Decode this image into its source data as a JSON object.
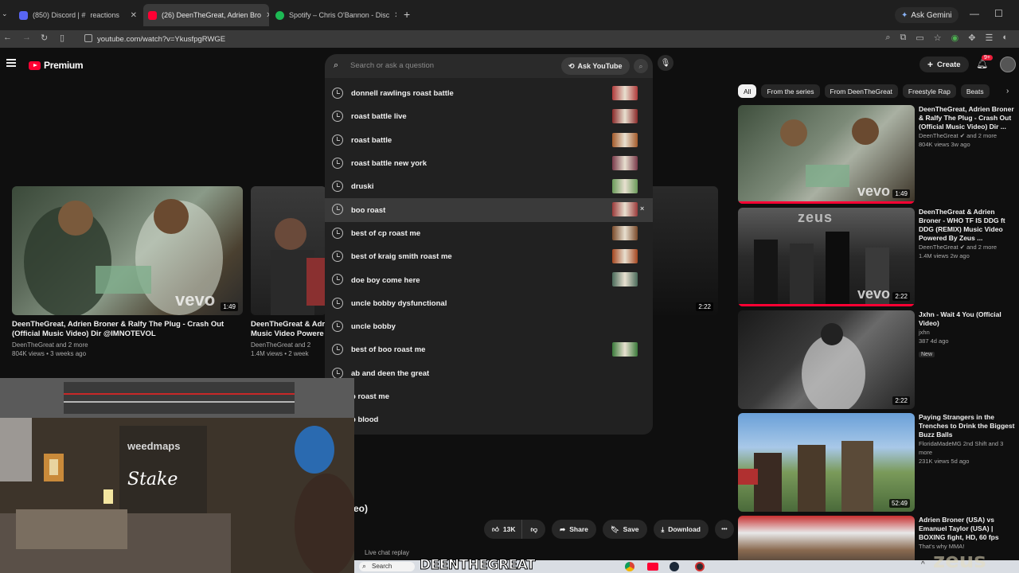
{
  "browser": {
    "tabs": [
      {
        "label": "(850) Discord | #",
        "extra": "reactions",
        "favicon_color": "#5865f2"
      },
      {
        "label": "(26) DeenTheGreat, Adrien Bro",
        "favicon_color": "#ff0033"
      },
      {
        "label": "Spotify – Chris O'Bannon - Disc",
        "favicon_color": "#1db954"
      }
    ],
    "new_tab": "+",
    "ask_gemini": "Ask Gemini",
    "url": "youtube.com/watch?v=YkusfpgRWGE"
  },
  "header": {
    "logo_text": "Premium",
    "search_placeholder": "Search or ask a question",
    "ask_youtube": "Ask YouTube",
    "create_label": "Create",
    "notif_count": "9+"
  },
  "suggestions": [
    {
      "text": "donnell rawlings roast battle",
      "has_thumb": true,
      "thumb_color": "#b03a3a"
    },
    {
      "text": "roast battle live",
      "has_thumb": true,
      "thumb_color": "#8a2a2a"
    },
    {
      "text": "roast battle",
      "has_thumb": true,
      "thumb_color": "#a35a2a"
    },
    {
      "text": "roast battle new york",
      "has_thumb": true,
      "thumb_color": "#7a3a4a"
    },
    {
      "text": "druski",
      "has_thumb": true,
      "thumb_color": "#6a9a5a"
    },
    {
      "text": "boo roast",
      "has_thumb": true,
      "thumb_color": "#9a3a3a",
      "hover": true,
      "remove": "×"
    },
    {
      "text": "best of cp roast me",
      "has_thumb": true,
      "thumb_color": "#7a4a2a"
    },
    {
      "text": "best of kraig smith roast me",
      "has_thumb": true,
      "thumb_color": "#a4461f"
    },
    {
      "text": "doe boy come here",
      "has_thumb": true,
      "thumb_color": "#4a6a5a"
    },
    {
      "text": "uncle bobby dysfunctional",
      "has_thumb": false
    },
    {
      "text": "uncle bobby",
      "has_thumb": false
    },
    {
      "text": "best of boo roast me",
      "has_thumb": true,
      "thumb_color": "#3a7a3a"
    },
    {
      "text": "ab and deen the great",
      "has_thumb": false
    },
    {
      "text": "p roast me",
      "has_thumb": false
    },
    {
      "text": "b blood",
      "has_thumb": false
    }
  ],
  "left_videos": [
    {
      "title": "DeenTheGreat, Adrien Broner & Ralfy The Plug - Crash Out (Official Music Video) Dir @IMNOTEVOL",
      "channel": "DeenTheGreat and 2 more",
      "stats": "804K views • 3 weeks ago",
      "duration": "1:49",
      "watermark": "vevo"
    },
    {
      "title": "DeenTheGreat & Adr",
      "title2": "Music Video Powere",
      "channel": "DeenTheGreat and 2",
      "stats": "1.4M views • 2 week",
      "duration": ""
    },
    {
      "duration": "2:22"
    }
  ],
  "chips": [
    "All",
    "From the series",
    "From DeenTheGreat",
    "Freestyle Rap",
    "Beats"
  ],
  "right_videos": [
    {
      "title": "DeenTheGreat, Adrien Broner & Ralfy The Plug - Crash Out (Official Music Video) Dir ...",
      "channel": "DeenTheGreat",
      "channel_more": "and 2 more",
      "stats": "804K views  3w ago",
      "duration": "1:49",
      "progress": 1.0,
      "watermark": "vevo"
    },
    {
      "title": "DeenTheGreat & Adrien Broner - WHO TF IS DDG ft DDG (REMIX) Music Video Powered By Zeus ...",
      "channel": "DeenTheGreat",
      "channel_more": "and 2 more",
      "stats": "1.4M views  2w ago",
      "duration": "2:22",
      "progress": 1.0,
      "watermark": "vevo",
      "overlay_text": "zeus"
    },
    {
      "title": "Jxhn - Wait 4 You (Official Video)",
      "channel": "jxhn",
      "stats": "387  4d ago",
      "badge": "New",
      "duration": "2:22"
    },
    {
      "title": "Paying Strangers in the Trenches to Drink the Biggest Buzz Balls",
      "channel": "FloridaMadeMG 2nd Shift and 3 more",
      "stats": "231K views  5d ago",
      "duration": "52:49"
    },
    {
      "title": "Adrien Broner (USA) vs Emanuel Taylor (USA) | BOXING fight, HD, 60 fps",
      "channel": "That's why MMA!",
      "stats": "",
      "duration": ""
    }
  ],
  "actions": {
    "likes": "13K",
    "share": "Share",
    "save": "Save",
    "download": "Download",
    "more": "•••"
  },
  "partial_title": "eo)",
  "live_chat": "Live chat replay",
  "webcam": {
    "sign_text": "weedmaps",
    "stake_text": "Stake"
  },
  "taskbar": {
    "search": "Search"
  },
  "banner_text": "DEENTHEGREAT",
  "watermark_text": "zeus"
}
